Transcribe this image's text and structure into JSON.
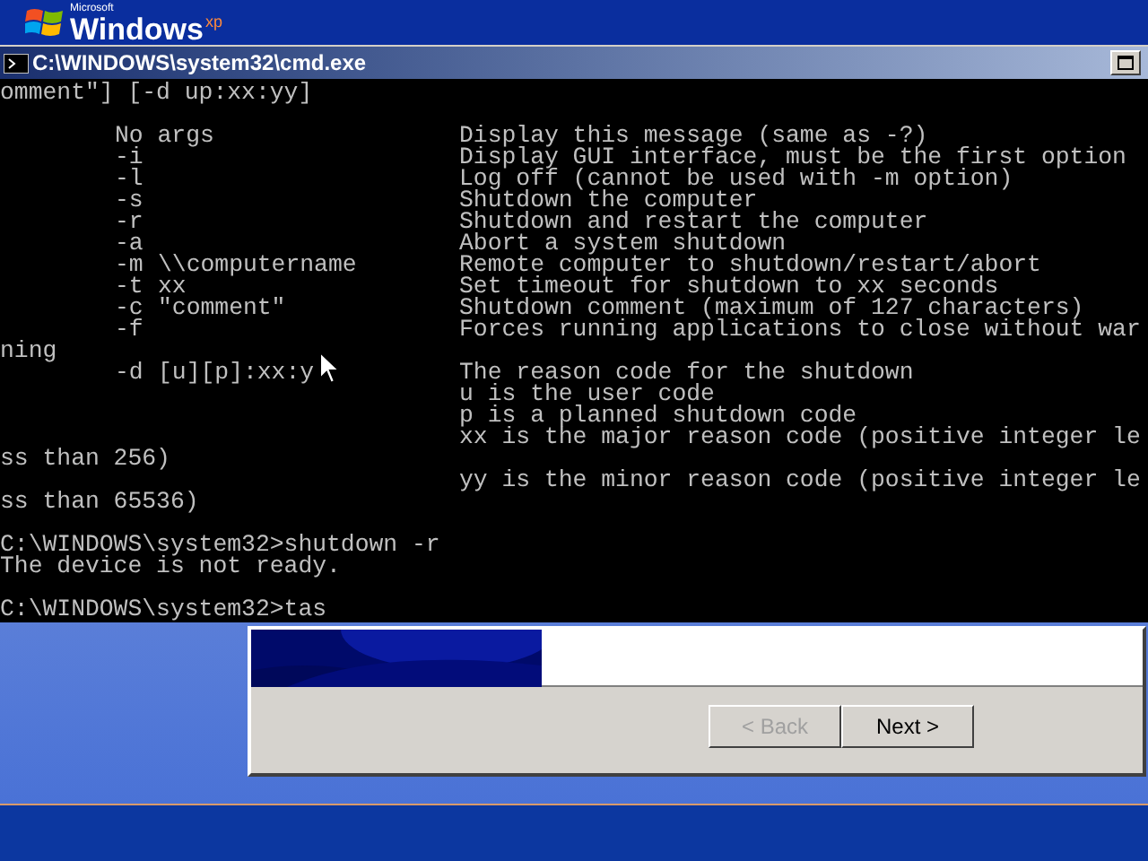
{
  "logo": {
    "company": "Microsoft",
    "product": "Windows",
    "edition": "xp"
  },
  "window": {
    "title": "C:\\WINDOWS\\system32\\cmd.exe"
  },
  "console_lines": [
    {
      "kind": "text",
      "text": "omment\"] [-d up:xx:yy]"
    },
    {
      "kind": "blank"
    },
    {
      "kind": "option",
      "flag": "No args",
      "description": "Display this message (same as -?)"
    },
    {
      "kind": "option",
      "flag": "-i",
      "description": "Display GUI interface, must be the first option"
    },
    {
      "kind": "option",
      "flag": "-l",
      "description": "Log off (cannot be used with -m option)"
    },
    {
      "kind": "option",
      "flag": "-s",
      "description": "Shutdown the computer"
    },
    {
      "kind": "option",
      "flag": "-r",
      "description": "Shutdown and restart the computer"
    },
    {
      "kind": "option",
      "flag": "-a",
      "description": "Abort a system shutdown"
    },
    {
      "kind": "option",
      "flag": "-m",
      "arg": "\\\\computername",
      "description": "Remote computer to shutdown/restart/abort"
    },
    {
      "kind": "option",
      "flag": "-t",
      "arg": "xx",
      "description": "Set timeout for shutdown to xx seconds"
    },
    {
      "kind": "option",
      "flag": "-c",
      "arg": "\"comment\"",
      "description": "Shutdown comment (maximum of 127 characters)"
    },
    {
      "kind": "option",
      "flag": "-f",
      "description": "Forces running applications to close without war"
    },
    {
      "kind": "text",
      "text": "ning"
    },
    {
      "kind": "option",
      "flag": "-d",
      "arg": "[u][p]:xx:y",
      "description": "The reason code for the shutdown"
    },
    {
      "kind": "option",
      "description": "u is the user code"
    },
    {
      "kind": "option",
      "description": "p is a planned shutdown code"
    },
    {
      "kind": "option",
      "description": "xx is the major reason code (positive integer le"
    },
    {
      "kind": "text",
      "text": "ss than 256)"
    },
    {
      "kind": "option",
      "description": "yy is the minor reason code (positive integer le"
    },
    {
      "kind": "text",
      "text": "ss than 65536)"
    },
    {
      "kind": "blank"
    },
    {
      "kind": "text",
      "text": "C:\\WINDOWS\\system32>shutdown -r"
    },
    {
      "kind": "text",
      "text": "The device is not ready."
    },
    {
      "kind": "blank"
    },
    {
      "kind": "text",
      "text": "C:\\WINDOWS\\system32>tas"
    }
  ],
  "wizard": {
    "buttons": [
      {
        "label": "< Back",
        "disabled": true
      },
      {
        "label": "Next >",
        "disabled": false
      }
    ]
  }
}
